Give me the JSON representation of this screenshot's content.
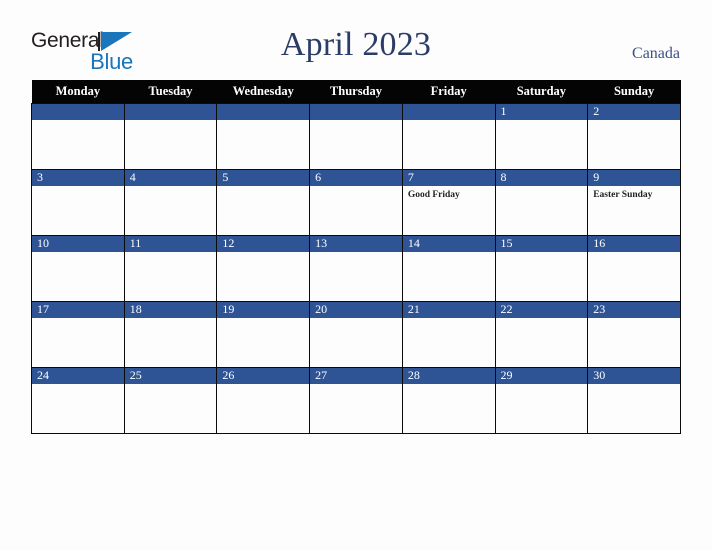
{
  "brand": {
    "name_part1": "General",
    "name_part2": "Blue",
    "triangle_color": "#1b75bb"
  },
  "header": {
    "title": "April 2023",
    "country": "Canada",
    "title_color": "#2b3d67",
    "country_color": "#3c5184"
  },
  "calendar": {
    "header_bg": "#040404",
    "daynum_bg": "#2e5496",
    "cell_bg": "#fdfdfd",
    "border_color": "#0b0b0b",
    "weekday_headers": [
      "Monday",
      "Tuesday",
      "Wednesday",
      "Thursday",
      "Friday",
      "Saturday",
      "Sunday"
    ],
    "weeks": [
      [
        {
          "day": "",
          "events": []
        },
        {
          "day": "",
          "events": []
        },
        {
          "day": "",
          "events": []
        },
        {
          "day": "",
          "events": []
        },
        {
          "day": "",
          "events": []
        },
        {
          "day": "1",
          "events": []
        },
        {
          "day": "2",
          "events": []
        }
      ],
      [
        {
          "day": "3",
          "events": []
        },
        {
          "day": "4",
          "events": []
        },
        {
          "day": "5",
          "events": []
        },
        {
          "day": "6",
          "events": []
        },
        {
          "day": "7",
          "events": [
            "Good Friday"
          ]
        },
        {
          "day": "8",
          "events": []
        },
        {
          "day": "9",
          "events": [
            "Easter Sunday"
          ]
        }
      ],
      [
        {
          "day": "10",
          "events": []
        },
        {
          "day": "11",
          "events": []
        },
        {
          "day": "12",
          "events": []
        },
        {
          "day": "13",
          "events": []
        },
        {
          "day": "14",
          "events": []
        },
        {
          "day": "15",
          "events": []
        },
        {
          "day": "16",
          "events": []
        }
      ],
      [
        {
          "day": "17",
          "events": []
        },
        {
          "day": "18",
          "events": []
        },
        {
          "day": "19",
          "events": []
        },
        {
          "day": "20",
          "events": []
        },
        {
          "day": "21",
          "events": []
        },
        {
          "day": "22",
          "events": []
        },
        {
          "day": "23",
          "events": []
        }
      ],
      [
        {
          "day": "24",
          "events": []
        },
        {
          "day": "25",
          "events": []
        },
        {
          "day": "26",
          "events": []
        },
        {
          "day": "27",
          "events": []
        },
        {
          "day": "28",
          "events": []
        },
        {
          "day": "29",
          "events": []
        },
        {
          "day": "30",
          "events": []
        }
      ]
    ]
  }
}
